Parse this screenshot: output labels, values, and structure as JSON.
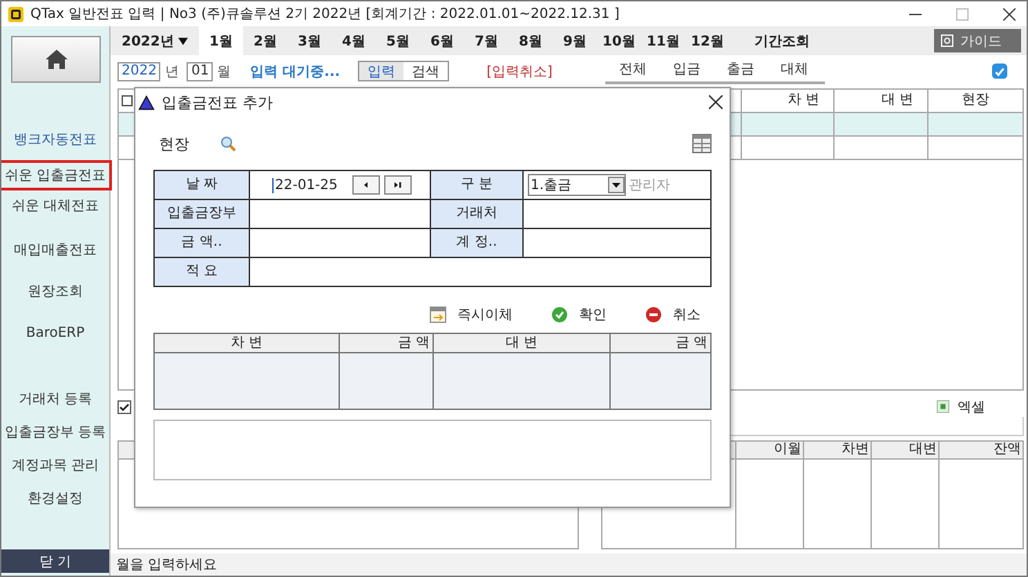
{
  "window": {
    "title": "QTax 일반전표 입력 | No3 (주)큐솔루션 2기 2022년 [회계기간 : 2022.01.01~2022.12.31 ]"
  },
  "sidebar": {
    "items": [
      {
        "label": "뱅크자동전표",
        "selected": false
      },
      {
        "label": "쉬운 입출금전표",
        "selected": true
      },
      {
        "label": "쉬운 대체전표",
        "selected": false
      },
      {
        "label": "매입매출전표",
        "selected": false
      },
      {
        "label": "원장조회",
        "selected": false
      },
      {
        "label": "BaroERP",
        "selected": false
      }
    ],
    "bottom_items": [
      "거래처 등록",
      "입출금장부 등록",
      "계정과목 관리",
      "환경설정"
    ],
    "close_button": "닫 기"
  },
  "month_bar": {
    "year": "2022년",
    "months": [
      {
        "label": "1월",
        "selected": true
      },
      {
        "label": "2월",
        "selected": false
      },
      {
        "label": "3월",
        "selected": false
      },
      {
        "label": "4월",
        "selected": false
      },
      {
        "label": "5월",
        "selected": false
      },
      {
        "label": "6월",
        "selected": false
      },
      {
        "label": "7월",
        "selected": false
      },
      {
        "label": "8월",
        "selected": false
      },
      {
        "label": "9월",
        "selected": false
      },
      {
        "label": "10월",
        "selected": false
      },
      {
        "label": "11월",
        "selected": false
      },
      {
        "label": "12월",
        "selected": false
      }
    ],
    "period": "기간조회",
    "guide": "가이드"
  },
  "entry_bar": {
    "year": "2022",
    "year_unit": "년",
    "month": "01",
    "month_unit": "월",
    "status": "입력 대기중...",
    "modes": [
      {
        "label": "입력",
        "selected": true
      },
      {
        "label": "검색",
        "selected": false
      }
    ],
    "cancel": "[입력취소]",
    "filters": [
      "전체",
      "입금",
      "출금",
      "대체"
    ]
  },
  "upper_table": {
    "select_all_checked": false,
    "columns": [
      "차 변",
      "대 변",
      "현장"
    ]
  },
  "lower": {
    "checked": true,
    "excel": "엑셀",
    "columns": [
      "이월",
      "차변",
      "대변",
      "잔액"
    ]
  },
  "status_bar": "월을 입력하세요",
  "dialog": {
    "title": "입출금전표 추가",
    "site_label": "현장",
    "form": {
      "date_label": "날 짜",
      "date": "22-01-25",
      "type_label": "구 분",
      "type": "1.출금",
      "manager": "관리자",
      "book_label": "입출금장부",
      "partner_label": "거래처",
      "amount_label": "금 액..",
      "account_label": "계 정..",
      "memo_label": "적 요"
    },
    "buttons": [
      {
        "kind": "transfer",
        "label": "즉시이체"
      },
      {
        "kind": "ok",
        "label": "확인"
      },
      {
        "kind": "cancel",
        "label": "취소"
      }
    ],
    "grid_columns": [
      "차 변",
      "금 액",
      "대 변",
      "금 액"
    ]
  }
}
